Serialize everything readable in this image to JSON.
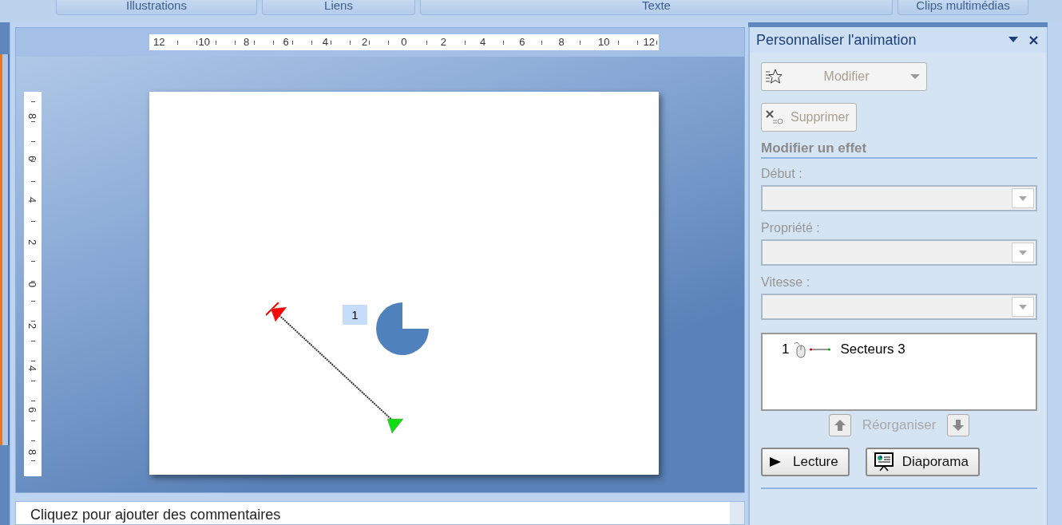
{
  "ribbon_groups": [
    "Illustrations",
    "Liens",
    "Texte",
    "Clips multimédias"
  ],
  "ruler": {
    "horizontal": [
      "12",
      "10",
      "8",
      "6",
      "4",
      "2",
      "0",
      "2",
      "4",
      "6",
      "8",
      "10",
      "12"
    ],
    "vertical": [
      "8",
      "6",
      "4",
      "2",
      "0",
      "2",
      "4",
      "6",
      "8"
    ]
  },
  "slide": {
    "sequence_tag": "1"
  },
  "task_pane": {
    "title": "Personnaliser l'animation",
    "buttons": [
      {
        "kind": "modify",
        "label": "Modifier",
        "disabled": true
      },
      {
        "kind": "remove",
        "label": "Supprimer",
        "disabled": true
      }
    ],
    "section_title": "Modifier un effet",
    "fields": [
      {
        "label": "Début :",
        "disabled": true
      },
      {
        "label": "Propriété :",
        "disabled": true
      },
      {
        "label": "Vitesse :",
        "disabled": true
      }
    ],
    "animation_list": [
      {
        "order": "1",
        "name": "Secteurs 3"
      }
    ],
    "reorder": {
      "label": "Réorganiser",
      "disabled": true
    },
    "play_buttons": [
      {
        "kind": "play",
        "label": "Lecture"
      },
      {
        "kind": "slideshow",
        "label": "Diaporama"
      }
    ]
  },
  "notes": {
    "prompt": "Cliquez pour ajouter des commentaires"
  }
}
